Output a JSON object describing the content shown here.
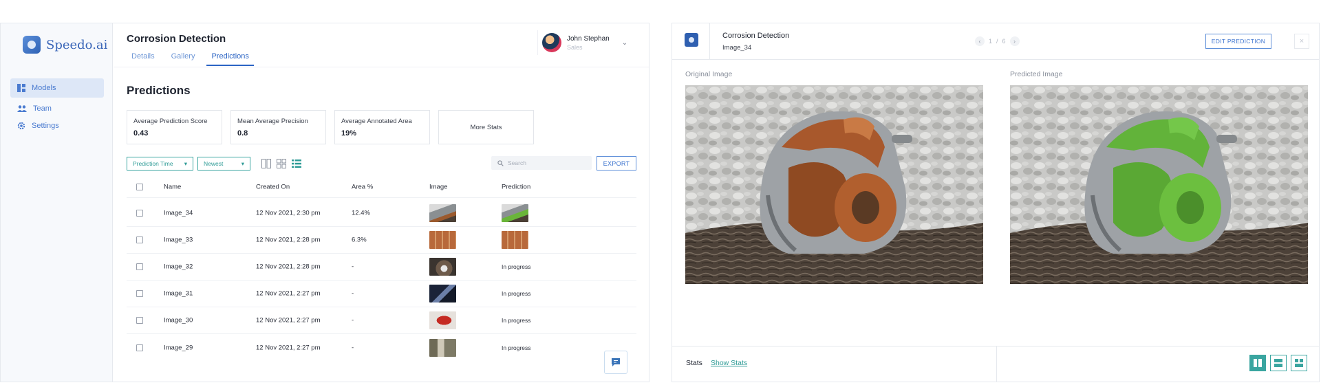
{
  "app": {
    "brand": "Speedo.ai",
    "sidebar": {
      "items": [
        {
          "label": "Models",
          "icon": "models-icon"
        },
        {
          "label": "Team",
          "icon": "team-icon"
        },
        {
          "label": "Settings",
          "icon": "settings-icon"
        }
      ]
    },
    "title": "Corrosion Detection",
    "tabs": [
      "Details",
      "Gallery",
      "Predictions"
    ],
    "user": {
      "name": "John Stephan",
      "role": "Sales"
    },
    "section_title": "Predictions",
    "stats": [
      {
        "label": "Average Prediction Score",
        "value": "0.43"
      },
      {
        "label": "Mean Average Precision",
        "value": "0.8"
      },
      {
        "label": "Average Annotated Area",
        "value": "19%"
      }
    ],
    "more_stats": "More Stats",
    "filters": {
      "sort_field": "Prediction Time",
      "sort_order": "Newest"
    },
    "search_placeholder": "Search",
    "export_label": "EXPORT",
    "table": {
      "columns": [
        "Name",
        "Created On",
        "Area %",
        "Image",
        "Prediction"
      ],
      "rows": [
        {
          "name": "Image_34",
          "created": "12 Nov 2021, 2:30 pm",
          "area": "12.4%",
          "prediction": ""
        },
        {
          "name": "Image_33",
          "created": "12 Nov 2021, 2:28 pm",
          "area": "6.3%",
          "prediction": ""
        },
        {
          "name": "Image_32",
          "created": "12 Nov 2021, 2:28 pm",
          "area": "-",
          "prediction": "In progress"
        },
        {
          "name": "Image_31",
          "created": "12 Nov 2021, 2:27 pm",
          "area": "-",
          "prediction": "In progress"
        },
        {
          "name": "Image_30",
          "created": "12 Nov 2021, 2:27 pm",
          "area": "-",
          "prediction": "In progress"
        },
        {
          "name": "Image_29",
          "created": "12 Nov 2021, 2:27 pm",
          "area": "-",
          "prediction": "In progress"
        }
      ]
    }
  },
  "preview": {
    "title": "Corrosion Detection",
    "subtitle": "Image_34",
    "pager": {
      "current": "1",
      "separator": "/",
      "total": "6"
    },
    "edit_label": "EDIT PREDICTION",
    "close_symbol": "×",
    "original_label": "Original Image",
    "predicted_label": "Predicted Image",
    "stats_label": "Stats",
    "show_stats": "Show Stats"
  },
  "colors": {
    "accent": "#2e9b96",
    "primary": "#3d74cf",
    "corrosion": "#a2542a",
    "mask": "#62b33a"
  }
}
